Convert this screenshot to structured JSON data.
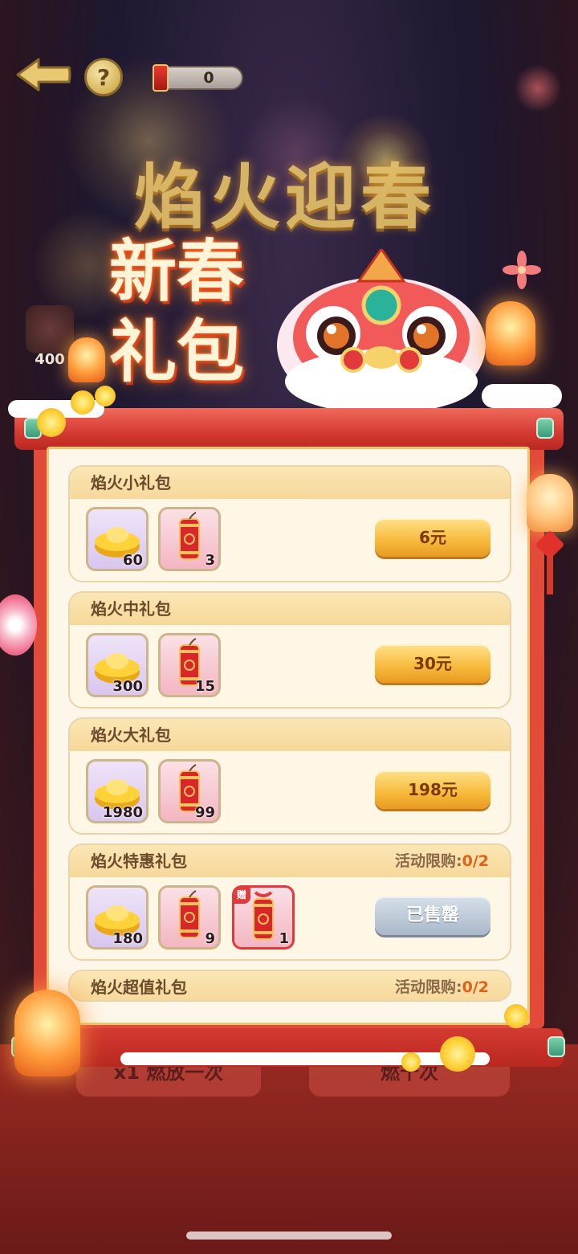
{
  "header": {
    "counter_value": "0",
    "help_label": "?"
  },
  "banner": {
    "title": "焰火迎春",
    "subtitle_line1": "新春",
    "subtitle_line2": "礼包",
    "side_badge_value": "400"
  },
  "packages": [
    {
      "title": "焰火小礼包",
      "limit_label": "",
      "limit_value": "",
      "items": [
        {
          "type": "gold-ingot-icon",
          "qty": "60"
        },
        {
          "type": "firecracker-icon",
          "qty": "3"
        }
      ],
      "button": "6元",
      "sold_out": false
    },
    {
      "title": "焰火中礼包",
      "limit_label": "",
      "limit_value": "",
      "items": [
        {
          "type": "gold-ingot-icon",
          "qty": "300"
        },
        {
          "type": "firecracker-icon",
          "qty": "15"
        }
      ],
      "button": "30元",
      "sold_out": false
    },
    {
      "title": "焰火大礼包",
      "limit_label": "",
      "limit_value": "",
      "items": [
        {
          "type": "gold-ingot-icon",
          "qty": "1980"
        },
        {
          "type": "firecracker-icon",
          "qty": "99"
        }
      ],
      "button": "198元",
      "sold_out": false
    },
    {
      "title": "焰火特惠礼包",
      "limit_label": "活动限购:",
      "limit_value": "0/2",
      "items": [
        {
          "type": "gold-ingot-icon",
          "qty": "180"
        },
        {
          "type": "firecracker-icon",
          "qty": "9"
        },
        {
          "type": "gift-firecracker-icon",
          "qty": "1",
          "tag": "赠"
        }
      ],
      "button": "已售罄",
      "sold_out": true
    },
    {
      "title": "焰火超值礼包",
      "limit_label": "活动限购:",
      "limit_value": "0/2"
    }
  ],
  "bottom": {
    "left_button": "x1 燃放一次",
    "right_button": "燃十次"
  },
  "colors": {
    "buy_button": "#f7b93a",
    "sold_out_button": "#aab8c8",
    "limit_value": "#e0601a",
    "scroll_red": "#d43a32"
  }
}
